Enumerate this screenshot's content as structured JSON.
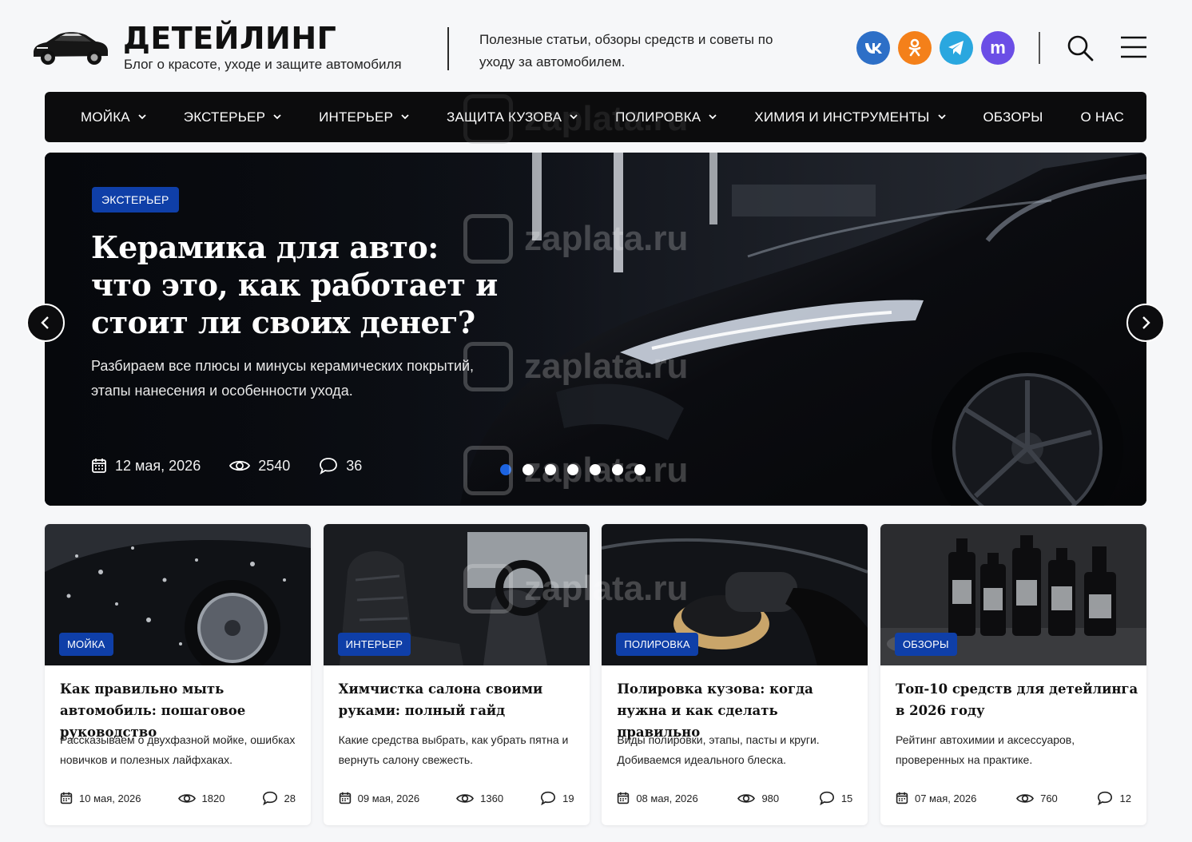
{
  "brand": {
    "title": "ДЕТЕЙЛИНГ",
    "subtitle": "Блог о красоте, уходе и защите автомобиля",
    "description": "Полезные статьи, обзоры средств и советы по уходу за автомобилем."
  },
  "socials": [
    {
      "name": "vk",
      "color": "#2d6fc7"
    },
    {
      "name": "odnoklassniki",
      "color": "#f4801a"
    },
    {
      "name": "telegram",
      "color": "#2aa7df"
    },
    {
      "name": "max",
      "color": "#6b4ee6",
      "label": "m"
    }
  ],
  "nav": [
    {
      "label": "МОЙКА",
      "dropdown": true
    },
    {
      "label": "ЭКСТЕРЬЕР",
      "dropdown": true
    },
    {
      "label": "ИНТЕРЬЕР",
      "dropdown": true
    },
    {
      "label": "ЗАЩИТА КУЗОВА",
      "dropdown": true
    },
    {
      "label": "ПОЛИРОВКА",
      "dropdown": true
    },
    {
      "label": "ХИМИЯ И ИНСТРУМЕНТЫ",
      "dropdown": true
    },
    {
      "label": "ОБЗОРЫ",
      "dropdown": false
    },
    {
      "label": "О НАС",
      "dropdown": false
    }
  ],
  "hero": {
    "category": "ЭКСТЕРЬЕР",
    "title": "Керамика для авто: что это, как работает и стоит ли своих денег?",
    "description": "Разбираем все плюсы и минусы керамических покрытий, этапы нанесения и особенности ухода.",
    "date": "12 мая, 2026",
    "views": "2540",
    "comments": "36",
    "slides_total": 7,
    "active_slide": 1
  },
  "cards": [
    {
      "category": "МОЙКА",
      "title": "Как правильно мыть автомобиль: пошаговое руководство",
      "description": "Рассказываем о двухфазной мойке, ошибках новичков и полезных лайфхаках.",
      "date": "10 мая, 2026",
      "views": "1820",
      "comments": "28"
    },
    {
      "category": "ИНТЕРЬЕР",
      "title": "Химчистка салона своими руками: полный гайд",
      "description": "Какие средства выбрать, как убрать пятна и вернуть салону свежесть.",
      "date": "09 мая, 2026",
      "views": "1360",
      "comments": "19"
    },
    {
      "category": "ПОЛИРОВКА",
      "title": "Полировка кузова: когда нужна и как сделать правильно",
      "description": "Виды полировки, этапы, пасты и круги. Добиваемся идеального блеска.",
      "date": "08 мая, 2026",
      "views": "980",
      "comments": "15"
    },
    {
      "category": "ОБЗОРЫ",
      "title": "Топ-10 средств для детейлинга в 2026 году",
      "description": "Рейтинг автохимии и аксессуаров, проверенных на практике.",
      "date": "07 мая, 2026",
      "views": "760",
      "comments": "12"
    }
  ],
  "watermark": "zaplata.ru",
  "colors": {
    "accent": "#0f3fa8",
    "nav_bg": "#0c0c0d",
    "dot_active": "#1c63e0"
  }
}
